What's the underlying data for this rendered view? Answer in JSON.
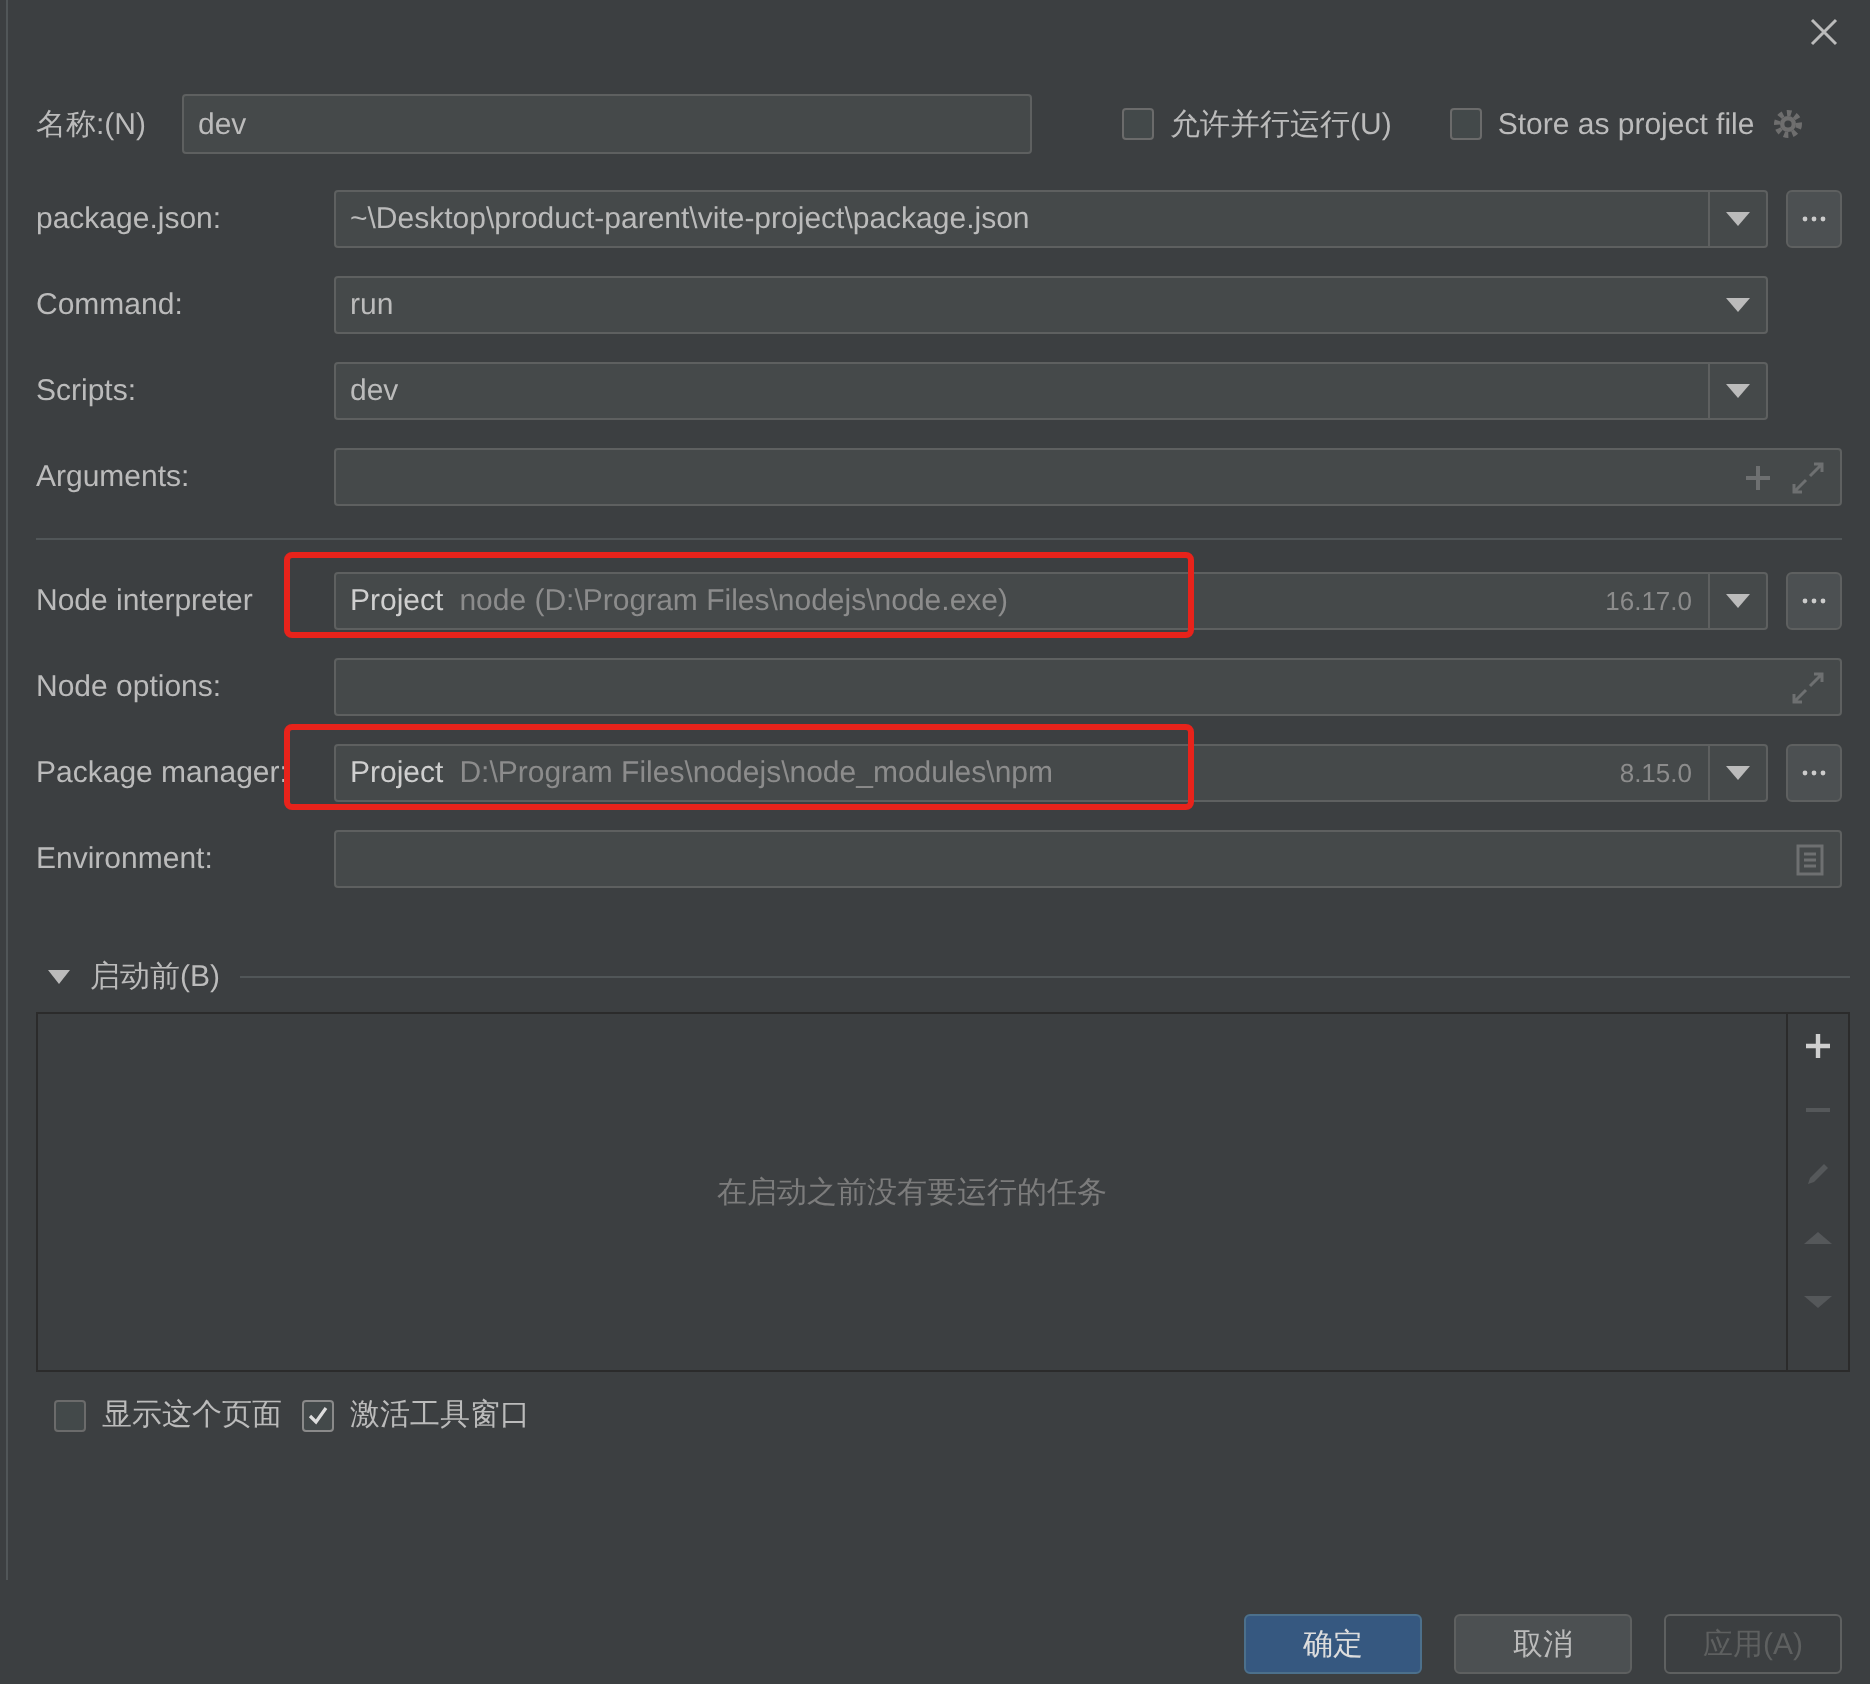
{
  "name_row": {
    "label": "名称:(N)",
    "value": "dev",
    "options": [
      {
        "label": "允许并行运行(U)",
        "checked": false
      },
      {
        "label": "Store as project file",
        "checked": false
      }
    ]
  },
  "field_groups": [
    [
      {
        "label": "package.json:",
        "kind": "combo",
        "value": "~\\Desktop\\product-parent\\vite-project\\package.json",
        "browse": true,
        "highlighted": false
      },
      {
        "label": "Command:",
        "kind": "select",
        "value": "run",
        "browse": false,
        "highlighted": false
      },
      {
        "label": "Scripts:",
        "kind": "combo",
        "value": "dev",
        "browse": false,
        "highlighted": false
      },
      {
        "label": "Arguments:",
        "kind": "args",
        "browse": false,
        "highlighted": false
      }
    ],
    [
      {
        "label": "Node interpreter",
        "kind": "interpreter",
        "prefix": "Project",
        "value": "node (D:\\Program Files\\nodejs\\node.exe)",
        "version": "16.17.0",
        "browse": true,
        "highlighted": true
      },
      {
        "label": "Node options:",
        "kind": "options",
        "browse": false,
        "highlighted": false
      },
      {
        "label": "Package manager:",
        "kind": "interpreter",
        "prefix": "Project",
        "value": "D:\\Program Files\\nodejs\\node_modules\\npm",
        "version": "8.15.0",
        "browse": true,
        "highlighted": true
      },
      {
        "label": "Environment:",
        "kind": "env",
        "browse": false,
        "highlighted": false
      }
    ]
  ],
  "before_launch": {
    "title": "启动前(B)",
    "expanded": true,
    "empty_text": "在启动之前没有要运行的任务",
    "tools": [
      {
        "kind": "add",
        "disabled": false
      },
      {
        "kind": "remove",
        "disabled": true
      },
      {
        "kind": "edit",
        "disabled": true
      },
      {
        "kind": "up",
        "disabled": true
      },
      {
        "kind": "down",
        "disabled": true
      }
    ]
  },
  "bottom_options": [
    {
      "label": "显示这个页面",
      "checked": false
    },
    {
      "label": "激活工具窗口",
      "checked": true
    }
  ],
  "buttons": [
    {
      "label": "确定",
      "kind": "primary",
      "disabled": false
    },
    {
      "label": "取消",
      "kind": "normal",
      "disabled": false
    },
    {
      "label": "应用(A)",
      "kind": "normal",
      "disabled": true
    }
  ]
}
